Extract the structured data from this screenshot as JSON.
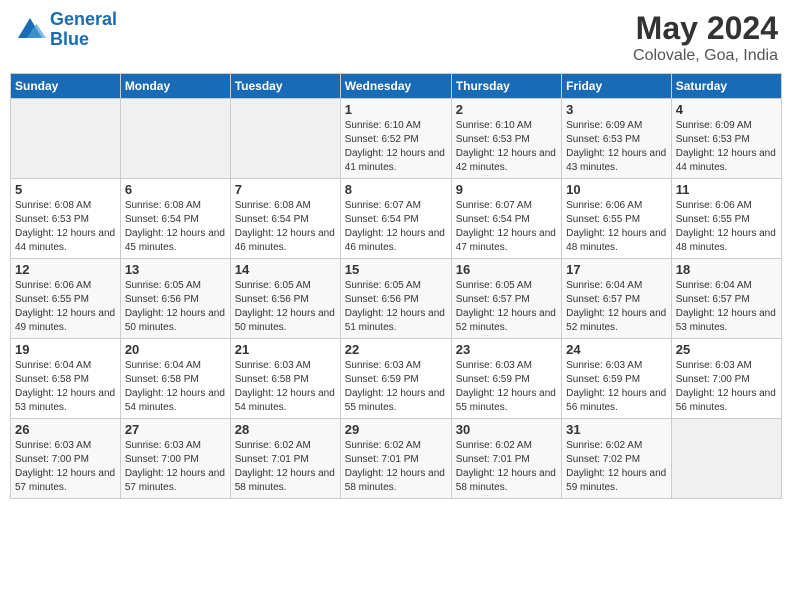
{
  "app": {
    "name": "GeneralBlue",
    "logo_text_part1": "General",
    "logo_text_part2": "Blue"
  },
  "calendar": {
    "title": "May 2024",
    "subtitle": "Colovale, Goa, India"
  },
  "headers": [
    "Sunday",
    "Monday",
    "Tuesday",
    "Wednesday",
    "Thursday",
    "Friday",
    "Saturday"
  ],
  "weeks": [
    {
      "days": [
        {
          "num": "",
          "info": ""
        },
        {
          "num": "",
          "info": ""
        },
        {
          "num": "",
          "info": ""
        },
        {
          "num": "1",
          "info": "Sunrise: 6:10 AM\nSunset: 6:52 PM\nDaylight: 12 hours and 41 minutes."
        },
        {
          "num": "2",
          "info": "Sunrise: 6:10 AM\nSunset: 6:53 PM\nDaylight: 12 hours and 42 minutes."
        },
        {
          "num": "3",
          "info": "Sunrise: 6:09 AM\nSunset: 6:53 PM\nDaylight: 12 hours and 43 minutes."
        },
        {
          "num": "4",
          "info": "Sunrise: 6:09 AM\nSunset: 6:53 PM\nDaylight: 12 hours and 44 minutes."
        }
      ]
    },
    {
      "days": [
        {
          "num": "5",
          "info": "Sunrise: 6:08 AM\nSunset: 6:53 PM\nDaylight: 12 hours and 44 minutes."
        },
        {
          "num": "6",
          "info": "Sunrise: 6:08 AM\nSunset: 6:54 PM\nDaylight: 12 hours and 45 minutes."
        },
        {
          "num": "7",
          "info": "Sunrise: 6:08 AM\nSunset: 6:54 PM\nDaylight: 12 hours and 46 minutes."
        },
        {
          "num": "8",
          "info": "Sunrise: 6:07 AM\nSunset: 6:54 PM\nDaylight: 12 hours and 46 minutes."
        },
        {
          "num": "9",
          "info": "Sunrise: 6:07 AM\nSunset: 6:54 PM\nDaylight: 12 hours and 47 minutes."
        },
        {
          "num": "10",
          "info": "Sunrise: 6:06 AM\nSunset: 6:55 PM\nDaylight: 12 hours and 48 minutes."
        },
        {
          "num": "11",
          "info": "Sunrise: 6:06 AM\nSunset: 6:55 PM\nDaylight: 12 hours and 48 minutes."
        }
      ]
    },
    {
      "days": [
        {
          "num": "12",
          "info": "Sunrise: 6:06 AM\nSunset: 6:55 PM\nDaylight: 12 hours and 49 minutes."
        },
        {
          "num": "13",
          "info": "Sunrise: 6:05 AM\nSunset: 6:56 PM\nDaylight: 12 hours and 50 minutes."
        },
        {
          "num": "14",
          "info": "Sunrise: 6:05 AM\nSunset: 6:56 PM\nDaylight: 12 hours and 50 minutes."
        },
        {
          "num": "15",
          "info": "Sunrise: 6:05 AM\nSunset: 6:56 PM\nDaylight: 12 hours and 51 minutes."
        },
        {
          "num": "16",
          "info": "Sunrise: 6:05 AM\nSunset: 6:57 PM\nDaylight: 12 hours and 52 minutes."
        },
        {
          "num": "17",
          "info": "Sunrise: 6:04 AM\nSunset: 6:57 PM\nDaylight: 12 hours and 52 minutes."
        },
        {
          "num": "18",
          "info": "Sunrise: 6:04 AM\nSunset: 6:57 PM\nDaylight: 12 hours and 53 minutes."
        }
      ]
    },
    {
      "days": [
        {
          "num": "19",
          "info": "Sunrise: 6:04 AM\nSunset: 6:58 PM\nDaylight: 12 hours and 53 minutes."
        },
        {
          "num": "20",
          "info": "Sunrise: 6:04 AM\nSunset: 6:58 PM\nDaylight: 12 hours and 54 minutes."
        },
        {
          "num": "21",
          "info": "Sunrise: 6:03 AM\nSunset: 6:58 PM\nDaylight: 12 hours and 54 minutes."
        },
        {
          "num": "22",
          "info": "Sunrise: 6:03 AM\nSunset: 6:59 PM\nDaylight: 12 hours and 55 minutes."
        },
        {
          "num": "23",
          "info": "Sunrise: 6:03 AM\nSunset: 6:59 PM\nDaylight: 12 hours and 55 minutes."
        },
        {
          "num": "24",
          "info": "Sunrise: 6:03 AM\nSunset: 6:59 PM\nDaylight: 12 hours and 56 minutes."
        },
        {
          "num": "25",
          "info": "Sunrise: 6:03 AM\nSunset: 7:00 PM\nDaylight: 12 hours and 56 minutes."
        }
      ]
    },
    {
      "days": [
        {
          "num": "26",
          "info": "Sunrise: 6:03 AM\nSunset: 7:00 PM\nDaylight: 12 hours and 57 minutes."
        },
        {
          "num": "27",
          "info": "Sunrise: 6:03 AM\nSunset: 7:00 PM\nDaylight: 12 hours and 57 minutes."
        },
        {
          "num": "28",
          "info": "Sunrise: 6:02 AM\nSunset: 7:01 PM\nDaylight: 12 hours and 58 minutes."
        },
        {
          "num": "29",
          "info": "Sunrise: 6:02 AM\nSunset: 7:01 PM\nDaylight: 12 hours and 58 minutes."
        },
        {
          "num": "30",
          "info": "Sunrise: 6:02 AM\nSunset: 7:01 PM\nDaylight: 12 hours and 58 minutes."
        },
        {
          "num": "31",
          "info": "Sunrise: 6:02 AM\nSunset: 7:02 PM\nDaylight: 12 hours and 59 minutes."
        },
        {
          "num": "",
          "info": ""
        }
      ]
    }
  ]
}
